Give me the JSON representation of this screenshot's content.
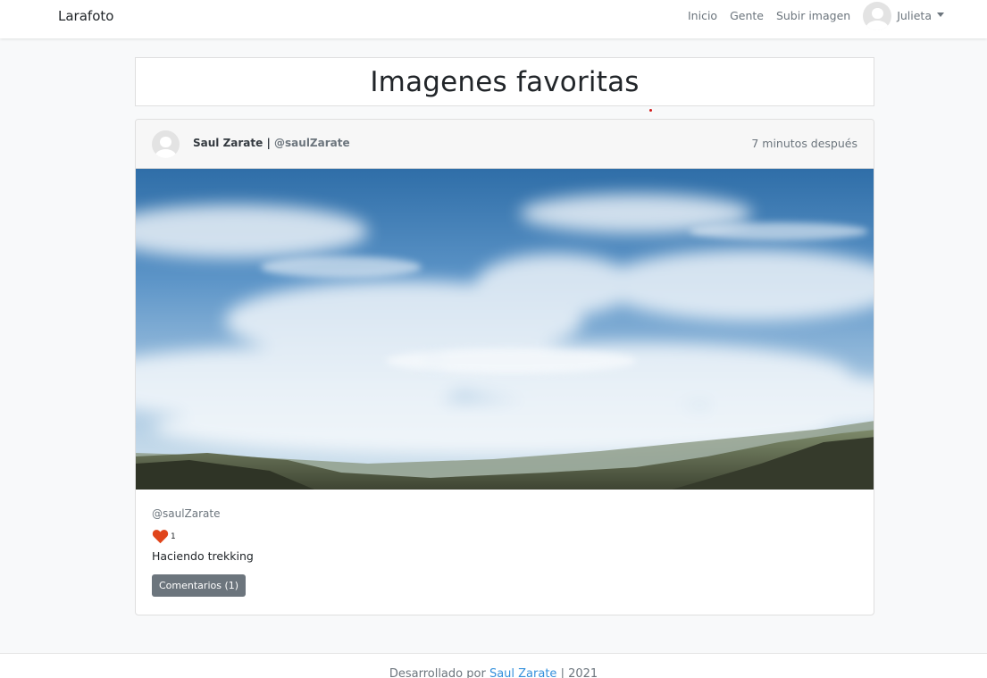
{
  "navbar": {
    "brand": "Larafoto",
    "links": [
      "Inicio",
      "Gente",
      "Subir imagen"
    ],
    "user_name": "Julieta"
  },
  "page": {
    "title": "Imagenes favoritas"
  },
  "post": {
    "author_name": "Saul Zarate",
    "separator": "|",
    "author_handle": "@saulZarate",
    "time_ago": "7 minutos después",
    "body_handle": "@saulZarate",
    "likes": "1",
    "description": "Haciendo trekking",
    "comments_button": "Comentarios (1)"
  },
  "footer": {
    "prefix": "Desarrollado por",
    "author": "Saul Zarate",
    "suffix": "| 2021"
  },
  "colors": {
    "like_heart": "#e0451b",
    "button_secondary": "#6c757d",
    "link": "#3490dc"
  }
}
